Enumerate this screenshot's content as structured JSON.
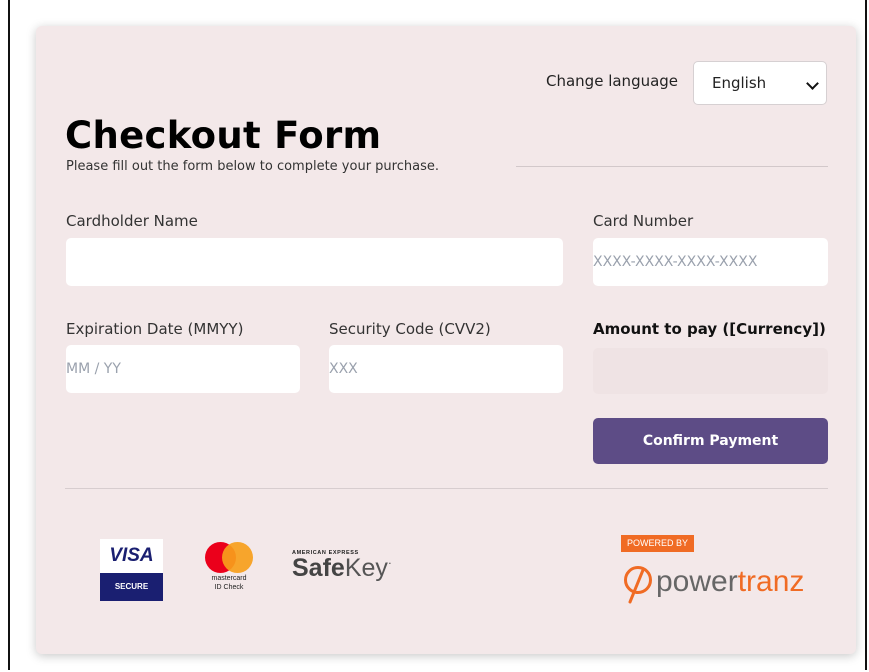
{
  "language": {
    "label": "Change language",
    "selected": "English"
  },
  "header": {
    "title": "Checkout Form",
    "subtitle": "Please fill out the form below to complete your purchase."
  },
  "form": {
    "cardholder_label": "Cardholder Name",
    "cardholder_value": "",
    "card_number_label": "Card Number",
    "card_number_placeholder": "XXXX-XXXX-XXXX-XXXX",
    "expiry_label": "Expiration Date (MMYY)",
    "expiry_placeholder": "MM / YY",
    "cvv_label": "Security Code (CVV2)",
    "cvv_placeholder": "XXX",
    "amount_label": "Amount to pay ([Currency])",
    "amount_value": "",
    "confirm_label": "Confirm Payment"
  },
  "badges": {
    "visa_top": "VISA",
    "visa_bottom": "SECURE",
    "mastercard_line1": "mastercard",
    "mastercard_line2": "ID Check",
    "amex_top": "AMERICAN EXPRESS",
    "amex_safe": "Safe",
    "amex_key": "Key",
    "amex_tm": "·",
    "powered_by": "POWERED BY",
    "powertranz_a": "power",
    "powertranz_b": "tranz"
  },
  "colors": {
    "accent": "#5d4c86",
    "card_bg": "#f3e8e9",
    "powertranz_orange": "#f06b24",
    "visa_blue": "#1a1f71"
  }
}
